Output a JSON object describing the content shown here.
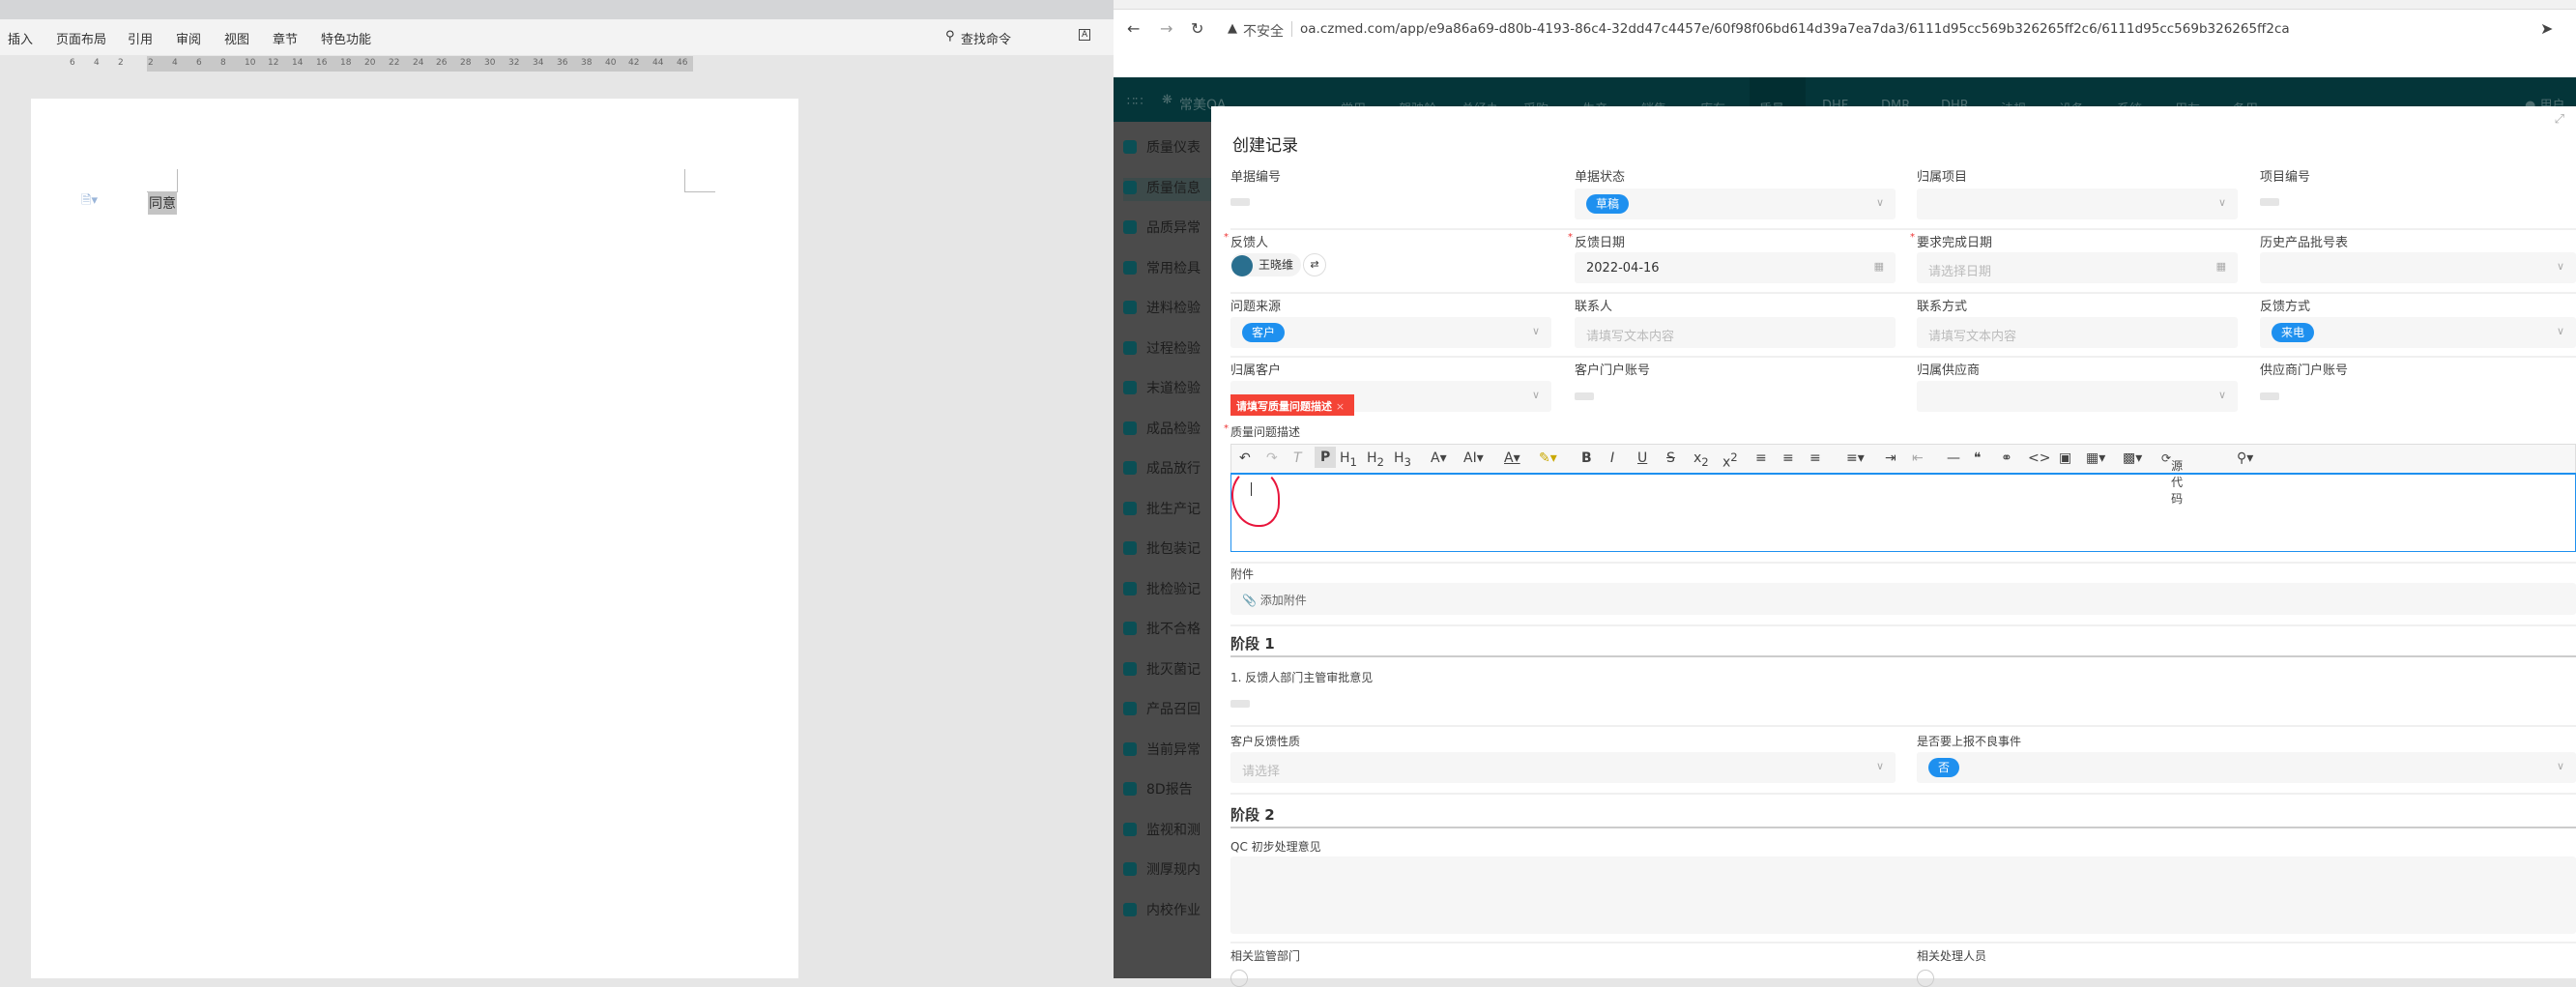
{
  "word": {
    "menu": [
      "插入",
      "页面布局",
      "引用",
      "审阅",
      "视图",
      "章节",
      "特色功能"
    ],
    "search": "查找命令",
    "ruler": [
      "6",
      "4",
      "2",
      "2",
      "4",
      "6",
      "8",
      "10",
      "12",
      "14",
      "16",
      "18",
      "20",
      "22",
      "24",
      "26",
      "28",
      "30",
      "32",
      "34",
      "36",
      "38",
      "40",
      "42",
      "44",
      "46"
    ],
    "doc_text": "同意"
  },
  "browser": {
    "insecure": "不安全",
    "url": "oa.czmed.com/app/e9a86a69-d80b-4193-86c4-32dd47c4457e/60f98f06bd614d39a7ea7da3/6111d95cc569b326265ff2c6/6111d95cc569b326265ff2ca"
  },
  "app": {
    "logo": "常美OA",
    "nav": [
      "常用",
      "驾驶舱",
      "总经办",
      "采购",
      "生产",
      "销售",
      "库存",
      "质量",
      "DHF",
      "DMR",
      "DHR",
      "法规",
      "设备",
      "系统",
      "用友",
      "备用"
    ],
    "user": "用户",
    "sidebar": [
      "质量仪表",
      "质量信息",
      "品质异常",
      "常用检具",
      "进料检验",
      "过程检验",
      "末道检验",
      "成品检验",
      "成品放行",
      "批生产记",
      "批包装记",
      "批检验记",
      "批不合格",
      "批灭菌记",
      "产品召回",
      "当前异常",
      "8D报告",
      "监视和测",
      "测厚规内",
      "内校作业"
    ]
  },
  "modal": {
    "title": "创建记录",
    "fields": {
      "doc_no": "单据编号",
      "status": "单据状态",
      "status_val": "草稿",
      "project": "归属项目",
      "project_no": "项目编号",
      "reporter": "反馈人",
      "reporter_val": "王晓维",
      "report_date": "反馈日期",
      "report_date_val": "2022-04-16",
      "due_date": "要求完成日期",
      "due_date_ph": "请选择日期",
      "history": "历史产品批号表",
      "source": "问题来源",
      "source_val": "客户",
      "contact": "联系人",
      "contact_ph": "请填写文本内容",
      "contact_way": "联系方式",
      "contact_way_ph": "请填写文本内容",
      "feedback_way": "反馈方式",
      "feedback_way_val": "来电",
      "customer": "归属客户",
      "customer_account": "客户门户账号",
      "supplier": "归属供应商",
      "supplier_account": "供应商门户账号",
      "error_tip": "请填写质量问题描述",
      "desc": "质量问题描述",
      "source_code": "源代码",
      "attach": "附件",
      "attach_btn": "添加附件",
      "stage1": "阶段 1",
      "approval": "1. 反馈人部门主管审批意见",
      "nature": "客户反馈性质",
      "nature_ph": "请选择",
      "adverse": "是否要上报不良事件",
      "adverse_val": "否",
      "stage2": "阶段 2",
      "qc": "QC 初步处理意见",
      "dept": "相关监管部门",
      "handler": "相关处理人员"
    }
  },
  "colors": {
    "accent": "#1e90ef",
    "error": "#f44336",
    "nav": "#043539"
  }
}
